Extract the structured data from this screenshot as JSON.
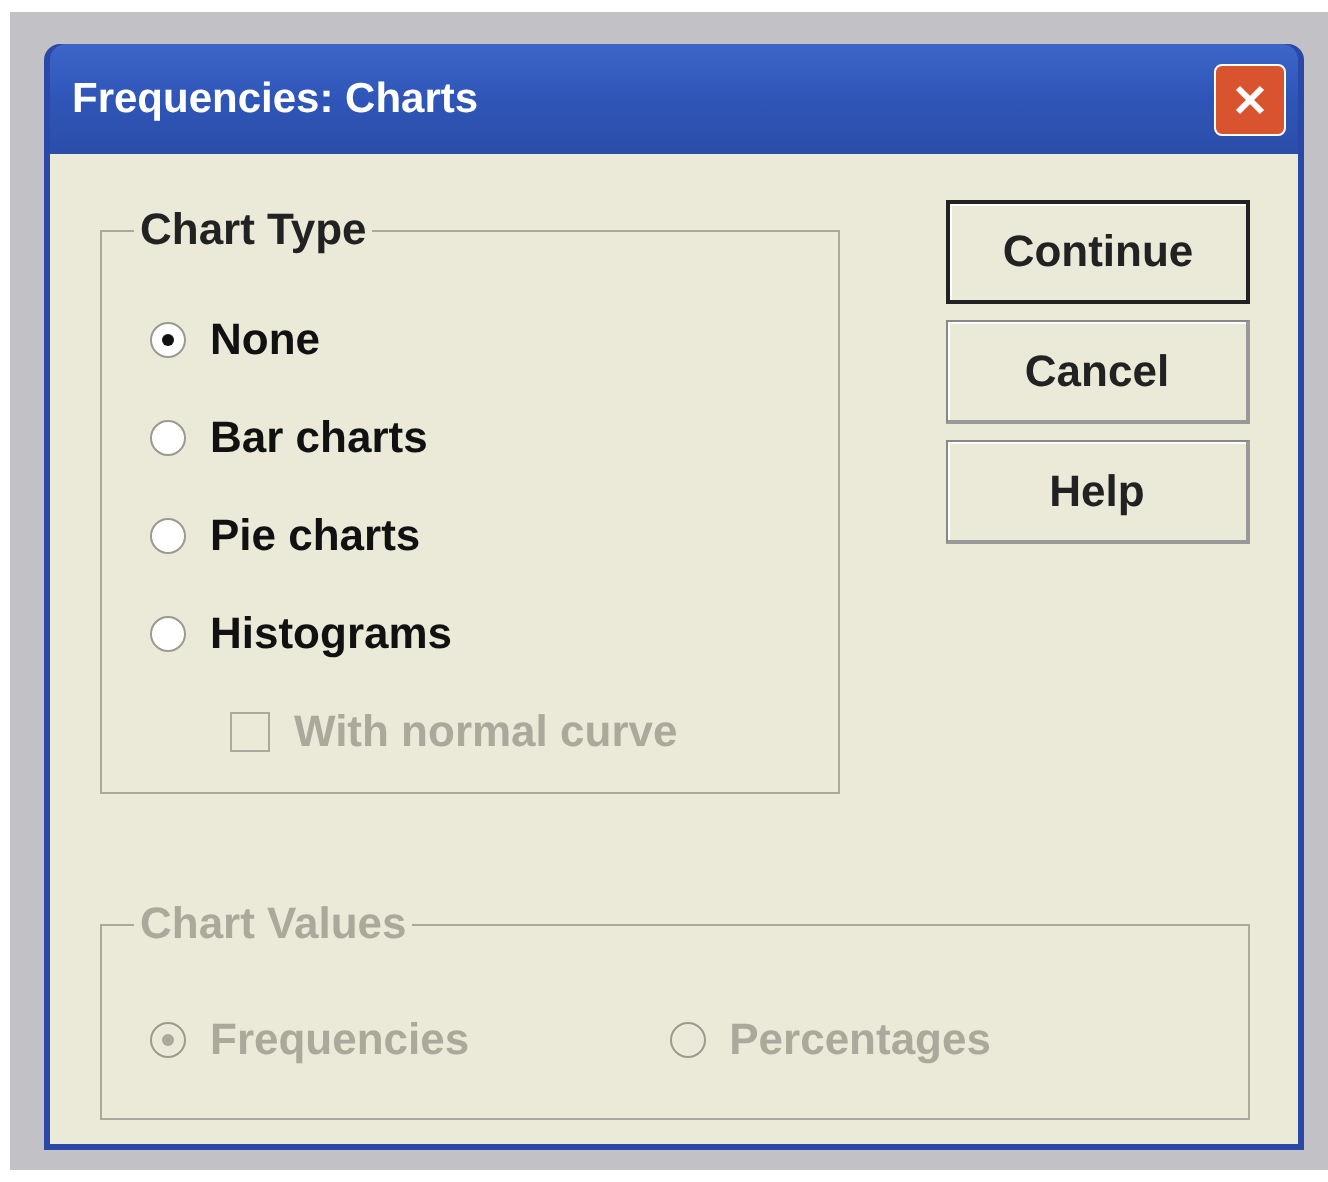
{
  "window": {
    "title": "Frequencies: Charts"
  },
  "chart_type": {
    "label": "Chart Type",
    "disabled": false,
    "options": [
      {
        "label": "None",
        "selected": true
      },
      {
        "label": "Bar charts",
        "selected": false
      },
      {
        "label": "Pie charts",
        "selected": false
      },
      {
        "label": "Histograms",
        "selected": false
      }
    ],
    "checkbox": {
      "label": "With normal curve",
      "checked": false,
      "disabled": true
    }
  },
  "chart_values": {
    "label": "Chart Values",
    "disabled": true,
    "options": [
      {
        "label": "Frequencies",
        "selected": true
      },
      {
        "label": "Percentages",
        "selected": false
      }
    ]
  },
  "buttons": [
    {
      "label": "Continue",
      "default": true
    },
    {
      "label": "Cancel",
      "default": false
    },
    {
      "label": "Help",
      "default": false
    }
  ]
}
